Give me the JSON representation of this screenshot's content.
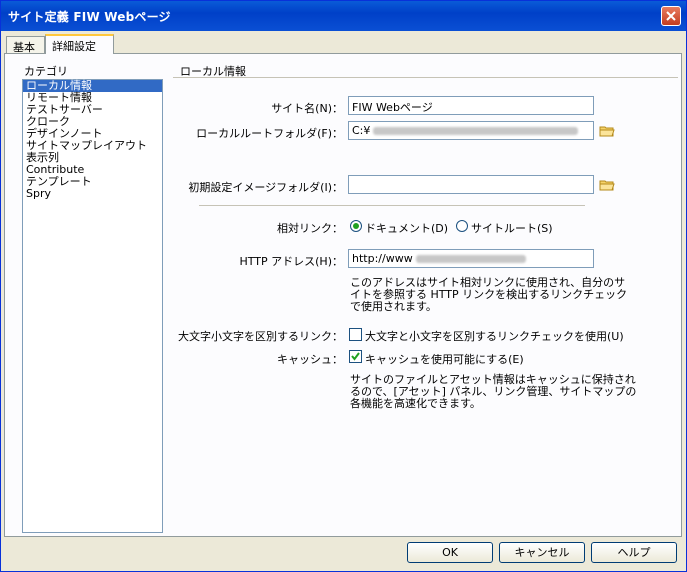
{
  "window": {
    "title": "サイト定義 FIW  Webページ"
  },
  "tabs": [
    {
      "label": "基本"
    },
    {
      "label": "詳細設定"
    }
  ],
  "category": {
    "label": "カテゴリ",
    "items": [
      "ローカル情報",
      "リモート情報",
      "テストサーバー",
      "クローク",
      "デザインノート",
      "サイトマップレイアウト",
      "表示列",
      "Contribute",
      "テンプレート",
      "Spry"
    ]
  },
  "section": {
    "title": "ローカル情報"
  },
  "site_name": {
    "label": "サイト名(N)：",
    "value": "FIW  Webページ"
  },
  "local_root": {
    "label": "ローカルルートフォルダ(F)：",
    "value": "C:¥"
  },
  "default_image": {
    "label": "初期設定イメージフォルダ(I)：",
    "value": ""
  },
  "relative_link": {
    "label": "相対リンク：",
    "option_document": "ドキュメント(D)",
    "option_site_root": "サイトルート(S)",
    "selected": "document"
  },
  "http_address": {
    "label": "HTTP アドレス(H)：",
    "value": "http://www",
    "description": [
      "このアドレスはサイト相対リンクに使用され、自分のサ",
      "イトを参照する HTTP リンクを検出するリンクチェック",
      "で使用されます。"
    ]
  },
  "case_sensitive": {
    "label": "大文字小文字を区別するリンク：",
    "option": "大文字と小文字を区別するリンクチェックを使用(U)",
    "checked": false
  },
  "cache": {
    "label": "キャッシュ：",
    "option": "キャッシュを使用可能にする(E)",
    "checked": true,
    "description": [
      "サイトのファイルとアセット情報はキャッシュに保持され",
      "るので、[アセット] パネル、リンク管理、サイトマップの",
      "各機能を高速化できます。"
    ]
  },
  "buttons": {
    "ok": "OK",
    "cancel": "キャンセル",
    "help": "ヘルプ"
  }
}
